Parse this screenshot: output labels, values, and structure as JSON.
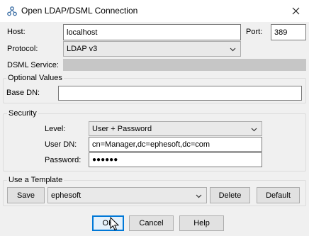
{
  "window": {
    "title": "Open LDAP/DSML Connection",
    "app_icon": "ldap-browser-icon",
    "close_icon": "close-icon"
  },
  "connection": {
    "host_label": "Host:",
    "host_value": "localhost",
    "port_label": "Port:",
    "port_value": "389",
    "protocol_label": "Protocol:",
    "protocol_value": "LDAP v3",
    "dsml_label": "DSML Service:",
    "optional_title": "Optional Values",
    "basedn_label": "Base DN:",
    "basedn_value": ""
  },
  "security": {
    "title": "Security",
    "level_label": "Level:",
    "level_value": "User + Password",
    "userdn_label": "User DN:",
    "userdn_value": "cn=Manager,dc=ephesoft,dc=com",
    "password_label": "Password:",
    "password_value": "●●●●●●"
  },
  "template": {
    "title": "Use a Template",
    "save_label": "Save",
    "selected": "ephesoft",
    "delete_label": "Delete",
    "default_label": "Default"
  },
  "footer": {
    "ok_label": "OK",
    "cancel_label": "Cancel",
    "help_label": "Help"
  }
}
